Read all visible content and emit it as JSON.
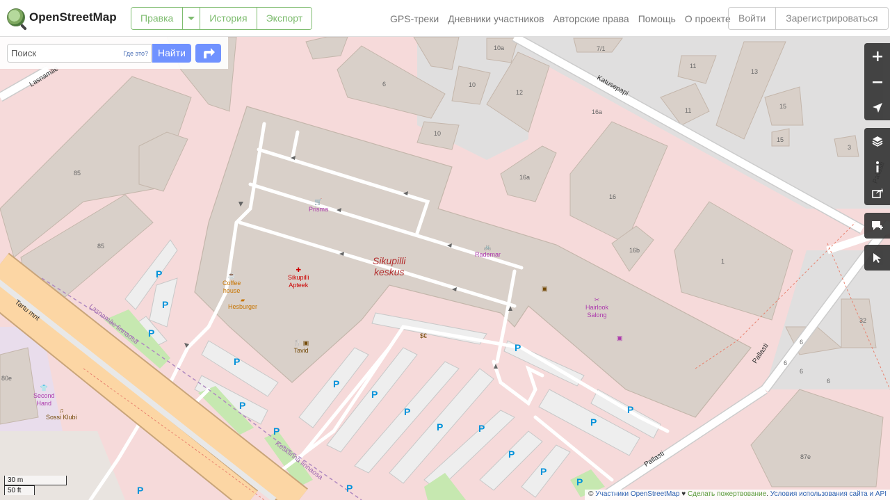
{
  "header": {
    "logo_text": "OpenStreetMap",
    "edit_buttons": [
      "Правка",
      "История",
      "Экспорт"
    ],
    "nav_links": [
      "GPS-треки",
      "Дневники участников",
      "Авторские права",
      "Помощь",
      "О проекте"
    ],
    "login": "Войти",
    "register": "Зарегистрироваться"
  },
  "search": {
    "placeholder": "Поиск",
    "where_link": "Где это?",
    "go_label": "Найти"
  },
  "map": {
    "mall_name": [
      "Sikupilli",
      "keskus"
    ],
    "streets": [
      "Lasnamäe",
      "Katusepapi",
      "Pallasti",
      "Tartu mnt",
      "Lasnamäe linnaosa",
      "Kesklinna linnaosa"
    ],
    "pois": [
      "Prisma",
      "Rademar",
      "Coffee",
      "house",
      "Hesburger",
      "Sikupilli",
      "Apteek",
      "Tavid",
      "Hairlook",
      "Salong",
      "Second",
      "Hand",
      "Sossi Klubi"
    ],
    "house_numbers": [
      "10a",
      "7/1",
      "6",
      "10",
      "12",
      "11",
      "13",
      "16a",
      "15",
      "11",
      "10",
      "15",
      "3",
      "16a",
      "16",
      "85",
      "16b",
      "1",
      "85",
      "32",
      "6",
      "6",
      "6",
      "6",
      "80e",
      "87e"
    ],
    "parking_label": "P"
  },
  "scale": {
    "metric": "30 m",
    "imperial": "50 ft"
  },
  "attribution": {
    "copyright": "© ",
    "contributors": "Участники OpenStreetMap",
    "heart": " ♥ ",
    "donate": "Сделать пожертвование",
    "sep": ". ",
    "terms": "Условия использования сайта и API"
  },
  "colors": {
    "brand_green": "#7ebc6f",
    "button_blue": "#7092ff",
    "retail_pink": "#f6dada",
    "building": "#d9d0c9",
    "primary_road": "#fcd6a4"
  }
}
